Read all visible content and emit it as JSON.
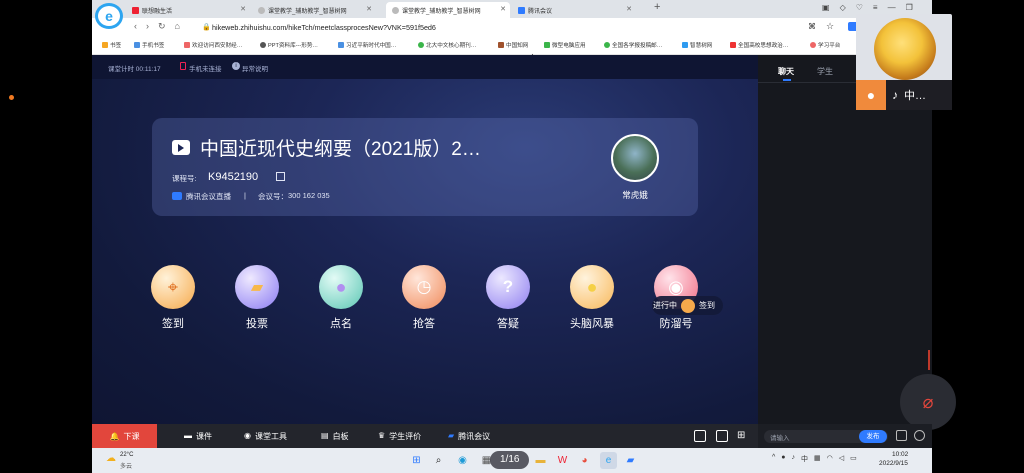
{
  "browser": {
    "tabs": [
      {
        "label": "联想融生活",
        "active": false
      },
      {
        "label": "课堂教学_辅助教学_智慧树网",
        "active": false
      },
      {
        "label": "课堂教学_辅助教学_智慧树网",
        "active": true
      },
      {
        "label": "腾讯会议",
        "active": false
      }
    ],
    "url": "hikeweb.zhihuishu.com/hikeTch/meetclassprocesNew?VNK=591f5ed6",
    "bookmarks": [
      "书签",
      "手机书签",
      "欢迎访问西安财经…",
      "PPT资料库---形势…",
      "习近平新时代中国…",
      "北大中文核心期刊…",
      "中国知网",
      "微型电脑应用",
      "全国各学报投稿邮…",
      "智慧树网",
      "全国高校思想政治…",
      "学习平台"
    ]
  },
  "topstrip": {
    "timer": "课堂计时 00:11:17",
    "phone": "手机未连接",
    "help": "异常说明"
  },
  "course": {
    "title": "中国近现代史纲要（2021版）2…",
    "code_label": "课程号:",
    "code": "K9452190",
    "platform": "腾讯会议直播",
    "separator": "|",
    "meeting_label": "会议号：",
    "meeting_number": "300 162 035",
    "teacher_name": "常虎娥"
  },
  "actions": [
    {
      "label": "签到",
      "icon": "location-pin-icon",
      "color": "#f6a94b"
    },
    {
      "label": "投票",
      "icon": "vote-ticket-icon",
      "color": "#8a7bf2"
    },
    {
      "label": "点名",
      "icon": "roll-call-ball-icon",
      "color": "#5cc7b4"
    },
    {
      "label": "抢答",
      "icon": "hand-clock-icon",
      "color": "#f08a5a"
    },
    {
      "label": "答疑",
      "icon": "question-answer-icon",
      "color": "#8f7ff0"
    },
    {
      "label": "头脑风暴",
      "icon": "lightbulb-icon",
      "color": "#f8b85a"
    },
    {
      "label": "防溜号",
      "icon": "eye-icon",
      "color": "#f06a82"
    }
  ],
  "progress_badge": {
    "status": "进行中",
    "label": "签到"
  },
  "side_tabs": [
    "聊天",
    "学生"
  ],
  "video_tile": {
    "name": "中…"
  },
  "bottom_bar": {
    "end_class": "下课",
    "items": [
      "课件",
      "课堂工具",
      "白板",
      "学生评价",
      "腾讯会议"
    ]
  },
  "chat": {
    "placeholder": "请输入",
    "send": "发布"
  },
  "taskbar": {
    "weather_temp": "22°C",
    "weather_desc": "多云",
    "page_counter": "1/16",
    "ime": "中",
    "time": "10:02",
    "date": "2022/9/15"
  },
  "colors": {
    "accent": "#2f7bff",
    "end_class": "#e2463c"
  }
}
